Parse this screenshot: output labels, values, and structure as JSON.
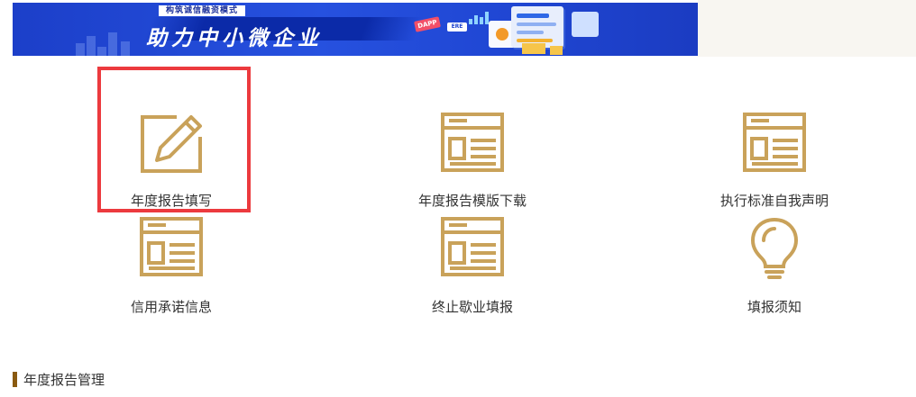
{
  "banner": {
    "tag": "构筑诚信融资模式",
    "headline": "助力中小微企业",
    "pill_a": "DAPP",
    "pill_b": "ERE"
  },
  "colors": {
    "icon_gold": "#c9a25a",
    "highlight": "#ec3a3e",
    "section_bar": "#8a5a10",
    "banner_blue": "#2651df"
  },
  "grid": {
    "items": [
      {
        "label": "年度报告填写",
        "icon": "edit-pencil-icon",
        "selected": true
      },
      {
        "label": "年度报告模版下载",
        "icon": "document-layout-icon",
        "selected": false
      },
      {
        "label": "执行标准自我声明",
        "icon": "document-layout-icon",
        "selected": false
      },
      {
        "label": "信用承诺信息",
        "icon": "document-layout-icon",
        "selected": false
      },
      {
        "label": "终止歇业填报",
        "icon": "document-layout-icon",
        "selected": false
      },
      {
        "label": "填报须知",
        "icon": "lightbulb-icon",
        "selected": false
      }
    ]
  },
  "section": {
    "title": "年度报告管理"
  }
}
